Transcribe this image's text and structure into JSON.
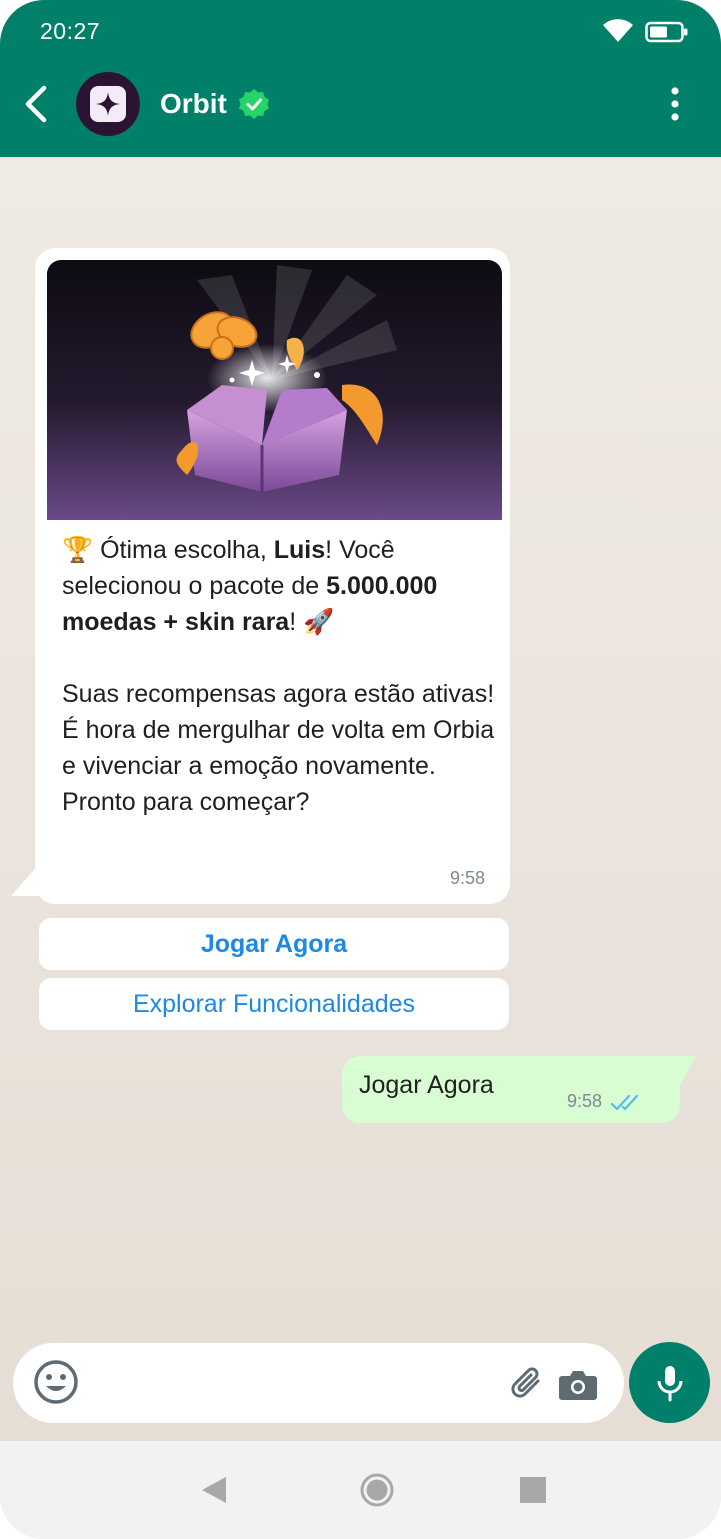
{
  "status_bar": {
    "time": "20:27"
  },
  "header": {
    "chat_name": "Orbit"
  },
  "incoming_message": {
    "line1_prefix": "🏆 Ótima escolha, ",
    "line1_name": "Luis",
    "line1_suffix": "! Você selecionou o pacote de",
    "line2_bold": "5.000.000 moedas + skin rara",
    "line2_suffix": "! 🚀",
    "paragraph2": "Suas recompensas agora estão ativas! É hora de mergulhar de volta em Orbia e vivenciar a emoção novamente. Pronto para começar?",
    "time": "9:58"
  },
  "quick_replies": [
    {
      "label": "Jogar Agora"
    },
    {
      "label": "Explorar Funcionalidades"
    }
  ],
  "outgoing_message": {
    "text": "Jogar Agora",
    "time": "9:58"
  },
  "colors": {
    "header": "#008069",
    "incoming_bubble": "#ffffff",
    "outgoing_bubble": "#d9fdd3",
    "link_blue": "#1e88e5",
    "read_ticks": "#53bdeb",
    "mic_button": "#00806a"
  },
  "icons": [
    "wifi-icon",
    "battery-icon",
    "back-icon",
    "verified-icon",
    "menu-icon",
    "emoji-icon",
    "attach-icon",
    "camera-icon",
    "mic-icon",
    "read-ticks-icon"
  ]
}
